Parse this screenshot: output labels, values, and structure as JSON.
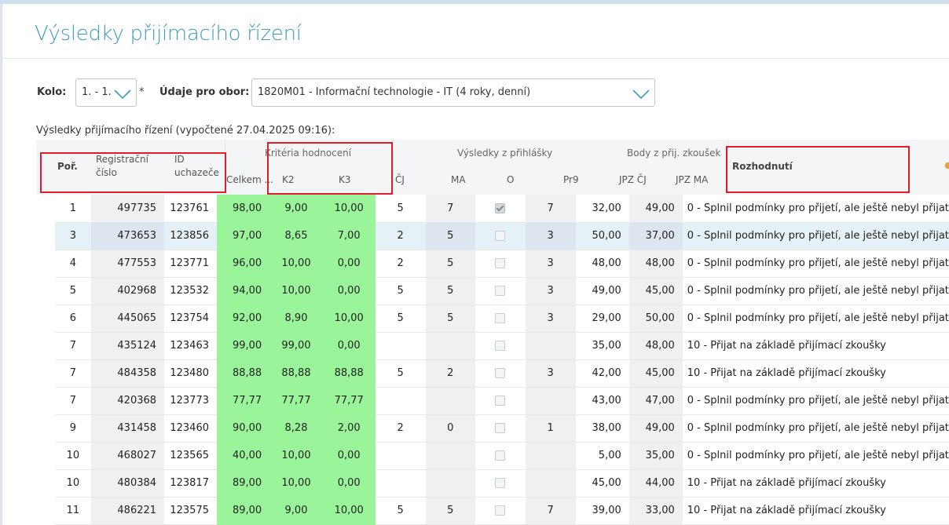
{
  "page": {
    "title": "Výsledky přijímacího řízení",
    "subtitle": "Výsledky přijímacího řízení (vypočtené 27.04.2025 09:16):"
  },
  "filters": {
    "kolo_label": "Kolo:",
    "kolo_value": "1. - 1.",
    "required_mark": "*",
    "obor_label": "Údaje pro obor:",
    "obor_value": "1820M01 - Informační technologie - IT (4 roky, denní)"
  },
  "table": {
    "headers": {
      "por": "Poř.",
      "reg_line1": "Registrační",
      "reg_line2": "číslo",
      "id_line1": "ID",
      "id_line2": "uchazeče",
      "kriteria_group": "Kritéria hodnocení",
      "celkem": "Celkem ...",
      "k2": "K2",
      "k3": "K3",
      "vysledky_group": "Výsledky z přihlášky",
      "cj": "ČJ",
      "ma": "MA",
      "o": "O",
      "pr9": "Pr9",
      "body_group": "Body z přij. zkoušek",
      "jpz_cj": "JPZ ČJ",
      "jpz_ma": "JPZ MA",
      "rozhodnuti": "Rozhodnutí"
    },
    "rows": [
      {
        "por": "1",
        "reg": "497735",
        "id": "123761",
        "celkem": "98,00",
        "k2": "9,00",
        "k3": "10,00",
        "cj": "5",
        "ma": "7",
        "o": true,
        "pr9": "7",
        "jpz_cj": "32,00",
        "jpz_ma": "49,00",
        "rozhodnuti": "0 - Splnil podmínky pro přijetí, ale ještě nebyl přijat"
      },
      {
        "por": "3",
        "reg": "473653",
        "id": "123856",
        "celkem": "97,00",
        "k2": "8,65",
        "k3": "7,00",
        "cj": "2",
        "ma": "5",
        "o": false,
        "pr9": "3",
        "jpz_cj": "50,00",
        "jpz_ma": "37,00",
        "rozhodnuti": "0 - Splnil podmínky pro přijetí, ale ještě nebyl přijat",
        "selected": true
      },
      {
        "por": "4",
        "reg": "477553",
        "id": "123771",
        "celkem": "96,00",
        "k2": "10,00",
        "k3": "0,00",
        "cj": "2",
        "ma": "5",
        "o": false,
        "pr9": "3",
        "jpz_cj": "48,00",
        "jpz_ma": "48,00",
        "rozhodnuti": "0 - Splnil podmínky pro přijetí, ale ještě nebyl přijat"
      },
      {
        "por": "5",
        "reg": "402968",
        "id": "123532",
        "celkem": "94,00",
        "k2": "10,00",
        "k3": "0,00",
        "cj": "5",
        "ma": "5",
        "o": false,
        "pr9": "3",
        "jpz_cj": "49,00",
        "jpz_ma": "45,00",
        "rozhodnuti": "0 - Splnil podmínky pro přijetí, ale ještě nebyl přijat"
      },
      {
        "por": "6",
        "reg": "445065",
        "id": "123754",
        "celkem": "92,00",
        "k2": "8,90",
        "k3": "10,00",
        "cj": "5",
        "ma": "5",
        "o": false,
        "pr9": "3",
        "jpz_cj": "29,00",
        "jpz_ma": "50,00",
        "rozhodnuti": "0 - Splnil podmínky pro přijetí, ale ještě nebyl přijat"
      },
      {
        "por": "7",
        "reg": "435124",
        "id": "123463",
        "celkem": "99,00",
        "k2": "99,00",
        "k3": "0,00",
        "cj": "",
        "ma": "",
        "o": false,
        "pr9": "",
        "jpz_cj": "35,00",
        "jpz_ma": "48,00",
        "rozhodnuti": "10 - Přijat na základě přijímací zkoušky"
      },
      {
        "por": "7",
        "reg": "484358",
        "id": "123480",
        "celkem": "88,88",
        "k2": "88,88",
        "k3": "88,88",
        "cj": "5",
        "ma": "2",
        "o": false,
        "pr9": "3",
        "jpz_cj": "42,00",
        "jpz_ma": "45,00",
        "rozhodnuti": "10 - Přijat na základě přijímací zkoušky"
      },
      {
        "por": "7",
        "reg": "420368",
        "id": "123773",
        "celkem": "77,77",
        "k2": "77,77",
        "k3": "77,77",
        "cj": "",
        "ma": "",
        "o": false,
        "pr9": "",
        "jpz_cj": "43,00",
        "jpz_ma": "47,00",
        "rozhodnuti": "0 - Splnil podmínky pro přijetí, ale ještě nebyl přijat"
      },
      {
        "por": "9",
        "reg": "431458",
        "id": "123460",
        "celkem": "90,00",
        "k2": "8,28",
        "k3": "2,00",
        "cj": "2",
        "ma": "0",
        "o": false,
        "pr9": "1",
        "jpz_cj": "38,00",
        "jpz_ma": "49,00",
        "rozhodnuti": "0 - Splnil podmínky pro přijetí, ale ještě nebyl přijat"
      },
      {
        "por": "10",
        "reg": "468027",
        "id": "123565",
        "celkem": "40,00",
        "k2": "10,00",
        "k3": "0,00",
        "cj": "",
        "ma": "",
        "o": false,
        "pr9": "",
        "jpz_cj": "5,00",
        "jpz_ma": "35,00",
        "rozhodnuti": "0 - Splnil podmínky pro přijetí, ale ještě nebyl přijat"
      },
      {
        "por": "10",
        "reg": "480384",
        "id": "123817",
        "celkem": "89,00",
        "k2": "10,00",
        "k3": "0,00",
        "cj": "",
        "ma": "",
        "o": false,
        "pr9": "",
        "jpz_cj": "45,00",
        "jpz_ma": "44,00",
        "rozhodnuti": "10 - Přijat na základě přijímací zkoušky"
      },
      {
        "por": "11",
        "reg": "486221",
        "id": "123575",
        "celkem": "89,00",
        "k2": "9,00",
        "k3": "10,00",
        "cj": "5",
        "ma": "5",
        "o": false,
        "pr9": "7",
        "jpz_cj": "39,00",
        "jpz_ma": "33,00",
        "rozhodnuti": "10 - Přijat na základě přijímací zkoušky"
      }
    ]
  },
  "colors": {
    "accent": "#3d9dc0",
    "highlight_box": "#e01e2b",
    "score_green": "#9af59a"
  }
}
